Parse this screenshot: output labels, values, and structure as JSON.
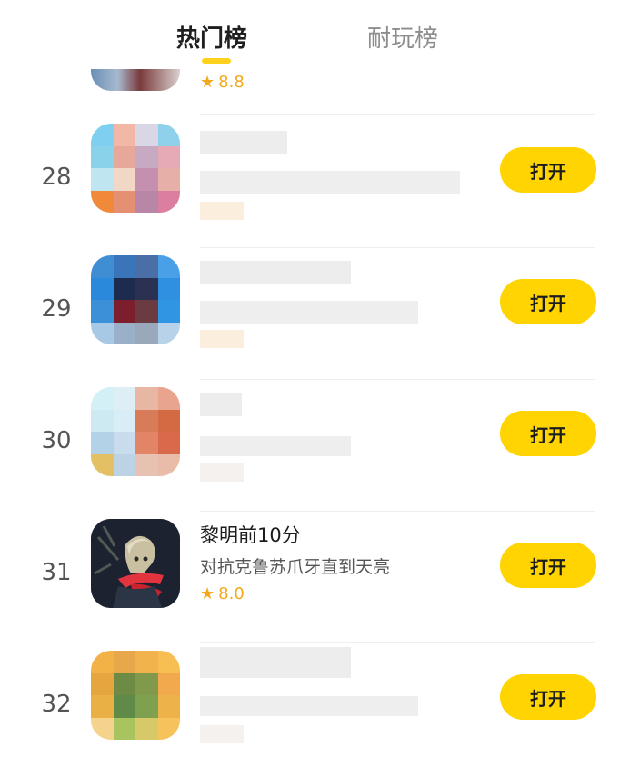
{
  "tabs": [
    {
      "label": "热门榜",
      "active": true
    },
    {
      "label": "耐玩榜",
      "active": false
    }
  ],
  "colors": {
    "accent": "#ffd400",
    "rating": "#f4a91d"
  },
  "previous_row": {
    "rating": "8.8"
  },
  "rows": [
    {
      "rank": "28",
      "button": "打开"
    },
    {
      "rank": "29",
      "button": "打开"
    },
    {
      "rank": "30",
      "button": "打开"
    },
    {
      "rank": "31",
      "title": "黎明前10分",
      "subtitle": "对抗克鲁苏爪牙直到天亮",
      "rating": "8.0",
      "button": "打开"
    },
    {
      "rank": "32",
      "button": "打开"
    }
  ]
}
